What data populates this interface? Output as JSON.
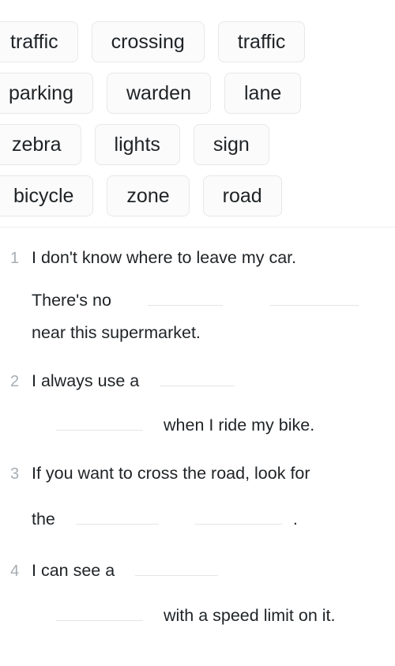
{
  "wordbank": {
    "rows": [
      [
        {
          "label": "traffic"
        },
        {
          "label": "crossing"
        },
        {
          "label": "traffic"
        }
      ],
      [
        {
          "label": "parking"
        },
        {
          "label": "warden"
        },
        {
          "label": "lane"
        }
      ],
      [
        {
          "label": "zebra"
        },
        {
          "label": "lights"
        },
        {
          "label": "sign"
        }
      ],
      [
        {
          "label": "bicycle"
        },
        {
          "label": "zone"
        },
        {
          "label": "road"
        }
      ]
    ]
  },
  "questions": [
    {
      "number": "1",
      "line1": "I don't know where to leave my car.",
      "line2_pre": "There's no",
      "line3": "near this supermarket.",
      "blank_widths": [
        95,
        112
      ]
    },
    {
      "number": "2",
      "line1_pre": "I always use a",
      "line2_post": "when I ride my bike.",
      "blank_widths": [
        95,
        110
      ]
    },
    {
      "number": "3",
      "line1": "If you want to cross the road, look for",
      "line2_pre": "the",
      "line2_end": ".",
      "blank_widths": [
        105,
        110
      ]
    },
    {
      "number": "4",
      "line1_pre": "I can see a",
      "line2_post": "with a speed limit on it.",
      "blank_widths": [
        105,
        110
      ]
    }
  ],
  "colors": {
    "chip_bg": "#fbfbfb",
    "chip_border": "#e6e8e9",
    "text": "#1f2326",
    "number": "#a7adb3",
    "blank_line": "#e2e5e8",
    "divider": "#eceef0",
    "page_bg": "#ffffff"
  }
}
